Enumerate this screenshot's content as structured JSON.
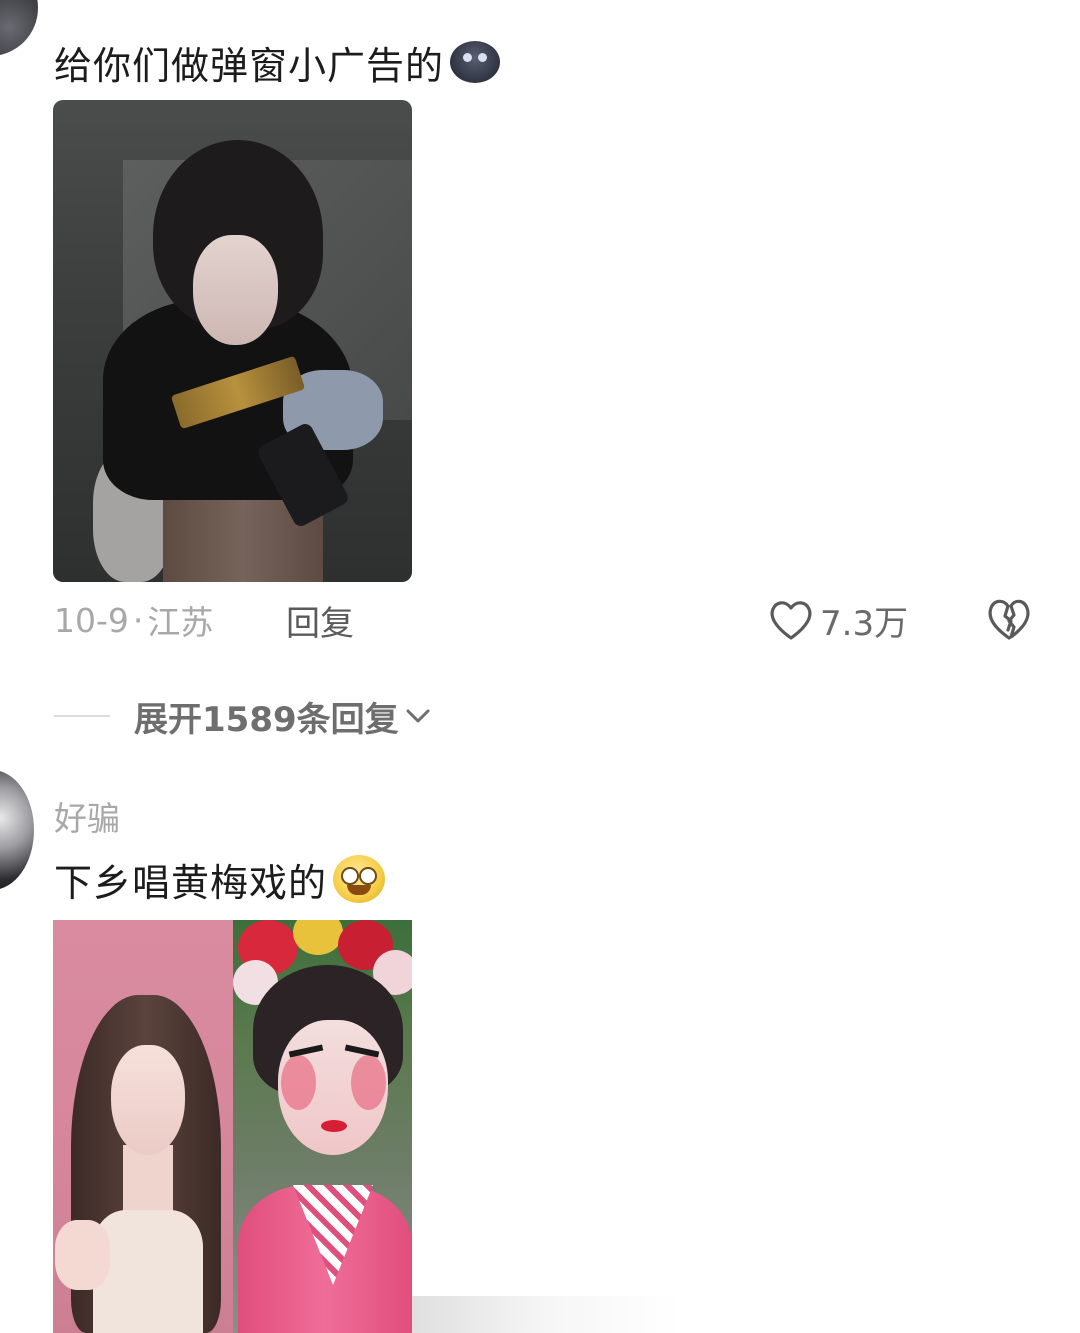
{
  "comments": [
    {
      "text": "给你们做弹窗小广告的",
      "emoji": "dark-blob-face-emoji",
      "meta": {
        "date": "10-9",
        "separator": "·",
        "location": "江苏"
      },
      "reply_label": "回复",
      "like_count": "7.3万",
      "expand_replies": "展开1589条回复"
    },
    {
      "username": "好骗",
      "text": "下乡唱黄梅戏的",
      "emoji": "grinning-face-emoji"
    }
  ],
  "icons": {
    "like": "heart-outline-icon",
    "dislike": "broken-heart-icon",
    "expand": "chevron-down-icon"
  },
  "colors": {
    "text_primary": "#1c1c1c",
    "text_meta": "#a8a8a8",
    "text_action": "#5a5a5a",
    "divider": "#dcdcdc"
  }
}
